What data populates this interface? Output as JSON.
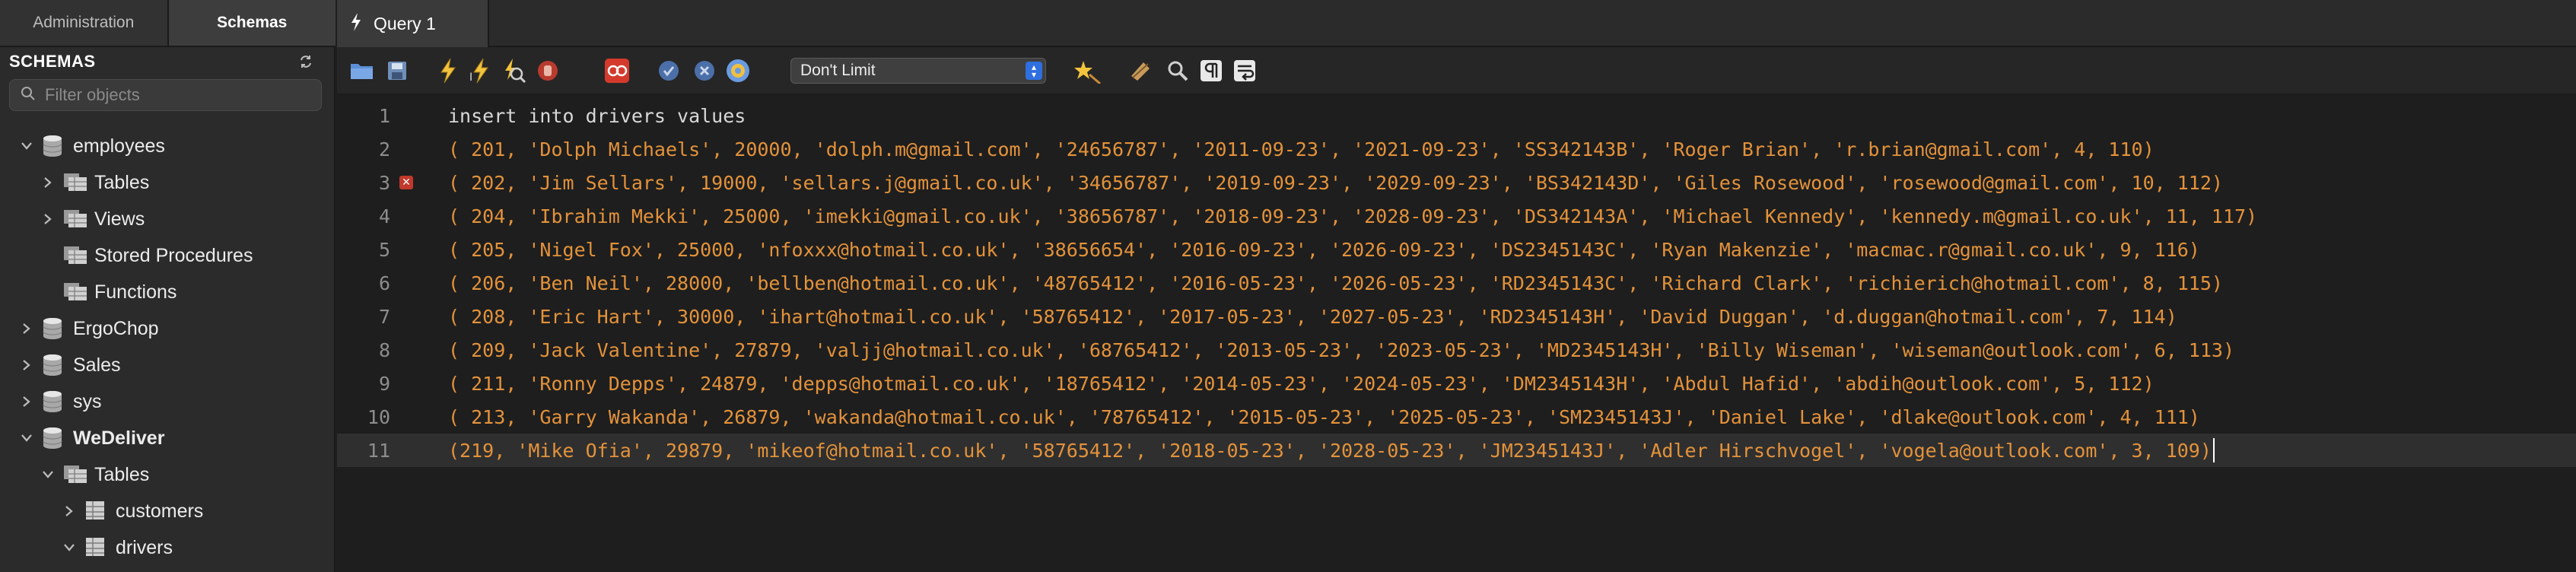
{
  "left_panel": {
    "tabs": [
      "Administration",
      "Schemas"
    ],
    "schemas_title": "SCHEMAS",
    "filter_placeholder": "Filter objects",
    "tree": [
      {
        "label": "employees",
        "bold": false,
        "level": 0,
        "expanded": true,
        "icon": "database-icon"
      },
      {
        "label": "Tables",
        "bold": false,
        "level": 1,
        "expanded": false,
        "icon": "tables-folder-icon"
      },
      {
        "label": "Views",
        "bold": false,
        "level": 1,
        "expanded": false,
        "icon": "views-folder-icon"
      },
      {
        "label": "Stored Procedures",
        "bold": false,
        "level": 1,
        "expanded": null,
        "icon": "procedures-folder-icon"
      },
      {
        "label": "Functions",
        "bold": false,
        "level": 1,
        "expanded": null,
        "icon": "functions-folder-icon"
      },
      {
        "label": "ErgoChop",
        "bold": false,
        "level": 0,
        "expanded": false,
        "icon": "database-icon"
      },
      {
        "label": "Sales",
        "bold": false,
        "level": 0,
        "expanded": false,
        "icon": "database-icon"
      },
      {
        "label": "sys",
        "bold": false,
        "level": 0,
        "expanded": false,
        "icon": "database-icon"
      },
      {
        "label": "WeDeliver",
        "bold": true,
        "level": 0,
        "expanded": true,
        "icon": "database-icon"
      },
      {
        "label": "Tables",
        "bold": false,
        "level": 1,
        "expanded": true,
        "icon": "tables-folder-icon"
      },
      {
        "label": "customers",
        "bold": false,
        "level": 2,
        "expanded": false,
        "icon": "table-icon"
      },
      {
        "label": "drivers",
        "bold": false,
        "level": 2,
        "expanded": true,
        "icon": "table-icon"
      }
    ]
  },
  "query_tab": {
    "label": "Query 1"
  },
  "toolbar": {
    "limit_value": "Don't Limit",
    "icons": [
      "open-file-icon",
      "save-icon",
      "execute-icon",
      "execute-current-icon",
      "explain-icon",
      "stop-icon",
      "toggle-error-icon",
      "commit-icon",
      "rollback-icon",
      "autocommit-icon",
      "limit-select",
      "beautify-icon",
      "find-icon",
      "invisible-chars-icon",
      "wrap-icon"
    ]
  },
  "editor": {
    "lines": [
      {
        "num": "1",
        "text": "insert into drivers values",
        "error": false,
        "current": false
      },
      {
        "num": "2",
        "text": "( 201, 'Dolph Michaels', 20000, 'dolph.m@gmail.com', '24656787', '2011-09-23', '2021-09-23', 'SS342143B', 'Roger Brian', 'r.brian@gmail.com', 4, 110)",
        "error": false,
        "current": false
      },
      {
        "num": "3",
        "text": "( 202, 'Jim Sellars', 19000, 'sellars.j@gmail.co.uk', '34656787', '2019-09-23', '2029-09-23', 'BS342143D', 'Giles Rosewood', 'rosewood@gmail.com', 10, 112)",
        "error": true,
        "current": false
      },
      {
        "num": "4",
        "text": "( 204, 'Ibrahim Mekki', 25000, 'imekki@gmail.co.uk', '38656787', '2018-09-23', '2028-09-23', 'DS342143A', 'Michael Kennedy', 'kennedy.m@gmail.co.uk', 11, 117)",
        "error": false,
        "current": false
      },
      {
        "num": "5",
        "text": "( 205, 'Nigel Fox', 25000, 'nfoxxx@hotmail.co.uk', '38656654', '2016-09-23', '2026-09-23', 'DS2345143C', 'Ryan Makenzie', 'macmac.r@gmail.co.uk', 9, 116)",
        "error": false,
        "current": false
      },
      {
        "num": "6",
        "text": "( 206, 'Ben Neil', 28000, 'bellben@hotmail.co.uk', '48765412', '2016-05-23', '2026-05-23', 'RD2345143C', 'Richard Clark', 'richierich@hotmail.com', 8, 115)",
        "error": false,
        "current": false
      },
      {
        "num": "7",
        "text": "( 208, 'Eric Hart', 30000, 'ihart@hotmail.co.uk', '58765412', '2017-05-23', '2027-05-23', 'RD2345143H', 'David Duggan', 'd.duggan@hotmail.com', 7, 114)",
        "error": false,
        "current": false
      },
      {
        "num": "8",
        "text": "( 209, 'Jack Valentine', 27879, 'valjj@hotmail.co.uk', '68765412', '2013-05-23', '2023-05-23', 'MD2345143H', 'Billy Wiseman', 'wiseman@outlook.com', 6, 113)",
        "error": false,
        "current": false
      },
      {
        "num": "9",
        "text": "( 211, 'Ronny Depps', 24879, 'depps@hotmail.co.uk', '18765412', '2014-05-23', '2024-05-23', 'DM2345143H', 'Abdul Hafid', 'abdih@outlook.com', 5, 112)",
        "error": false,
        "current": false
      },
      {
        "num": "10",
        "text": "( 213, 'Garry Wakanda', 26879, 'wakanda@hotmail.co.uk', '78765412', '2015-05-23', '2025-05-23', 'SM2345143J', 'Daniel Lake', 'dlake@outlook.com', 4, 111)",
        "error": false,
        "current": false
      },
      {
        "num": "11",
        "text": "(219, 'Mike Ofia', 29879, 'mikeof@hotmail.co.uk', '58765412', '2018-05-23', '2028-05-23', 'JM2345143J', 'Adler Hirschvogel', 'vogela@outlook.com', 3, 109)",
        "error": false,
        "current": true
      }
    ]
  },
  "colors": {
    "string": "#e3923b",
    "keyword": "#d8d8d8",
    "line_number": "#8d8d8d",
    "current_line": "#2f2f2f",
    "error_marker": "#c0392b"
  }
}
